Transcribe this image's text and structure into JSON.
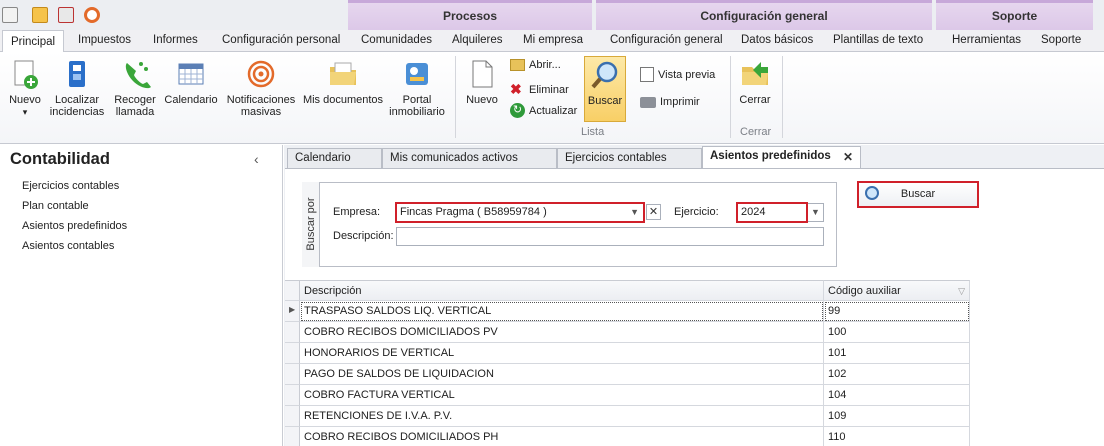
{
  "context_groups": {
    "procesos": "Procesos",
    "configuracion": "Configuración general",
    "soporte": "Soporte"
  },
  "tabs": {
    "principal": "Principal",
    "impuestos": "Impuestos",
    "informes": "Informes",
    "config_personal": "Configuración personal",
    "comunidades": "Comunidades",
    "alquileres": "Alquileres",
    "mi_empresa": "Mi empresa",
    "config_general": "Configuración general",
    "datos_basicos": "Datos básicos",
    "plantillas": "Plantillas de texto",
    "herramientas": "Herramientas",
    "soporte": "Soporte"
  },
  "ribbon": {
    "nuevo": "Nuevo",
    "localizar_1": "Localizar",
    "localizar_2": "incidencias",
    "recoger_1": "Recoger",
    "recoger_2": "llamada",
    "calendario": "Calendario",
    "notif_1": "Notificaciones",
    "notif_2": "masivas",
    "mis_docs": "Mis documentos",
    "portal_1": "Portal",
    "portal_2": "inmobiliario",
    "lista_nuevo": "Nuevo",
    "abrir": "Abrir...",
    "eliminar": "Eliminar",
    "actualizar": "Actualizar",
    "buscar": "Buscar",
    "vista_previa": "Vista previa",
    "imprimir": "Imprimir",
    "group_lista": "Lista",
    "cerrar": "Cerrar",
    "group_cerrar": "Cerrar"
  },
  "sidebar": {
    "title": "Contabilidad",
    "items": [
      "Ejercicios contables",
      "Plan contable",
      "Asientos predefinidos",
      "Asientos contables"
    ]
  },
  "doc_tabs": [
    "Calendario",
    "Mis comunicados activos",
    "Ejercicios contables",
    "Asientos predefinidos"
  ],
  "search": {
    "group_label": "Buscar por",
    "empresa_label": "Empresa:",
    "empresa_value": "Fincas Pragma ( B58959784 )",
    "ejercicio_label": "Ejercicio:",
    "ejercicio_value": "2024",
    "descripcion_label": "Descripción:",
    "descripcion_value": "",
    "buscar_button": "Buscar"
  },
  "grid": {
    "headers": [
      "Descripción",
      "Código auxiliar"
    ],
    "rows": [
      {
        "descripcion": "TRASPASO SALDOS LIQ. VERTICAL",
        "codigo": "99"
      },
      {
        "descripcion": "COBRO RECIBOS DOMICILIADOS PV",
        "codigo": "100"
      },
      {
        "descripcion": "HONORARIOS DE VERTICAL",
        "codigo": "101"
      },
      {
        "descripcion": "PAGO DE SALDOS DE LIQUIDACION",
        "codigo": "102"
      },
      {
        "descripcion": "COBRO FACTURA VERTICAL",
        "codigo": "104"
      },
      {
        "descripcion": "RETENCIONES DE I.V.A. P.V.",
        "codigo": "109"
      },
      {
        "descripcion": "COBRO RECIBOS DOMICILIADOS PH",
        "codigo": "110"
      }
    ]
  },
  "colors": {
    "highlight": "#d0202a",
    "context_purple": "#dcc8e8",
    "selection": "#fce7a8"
  }
}
